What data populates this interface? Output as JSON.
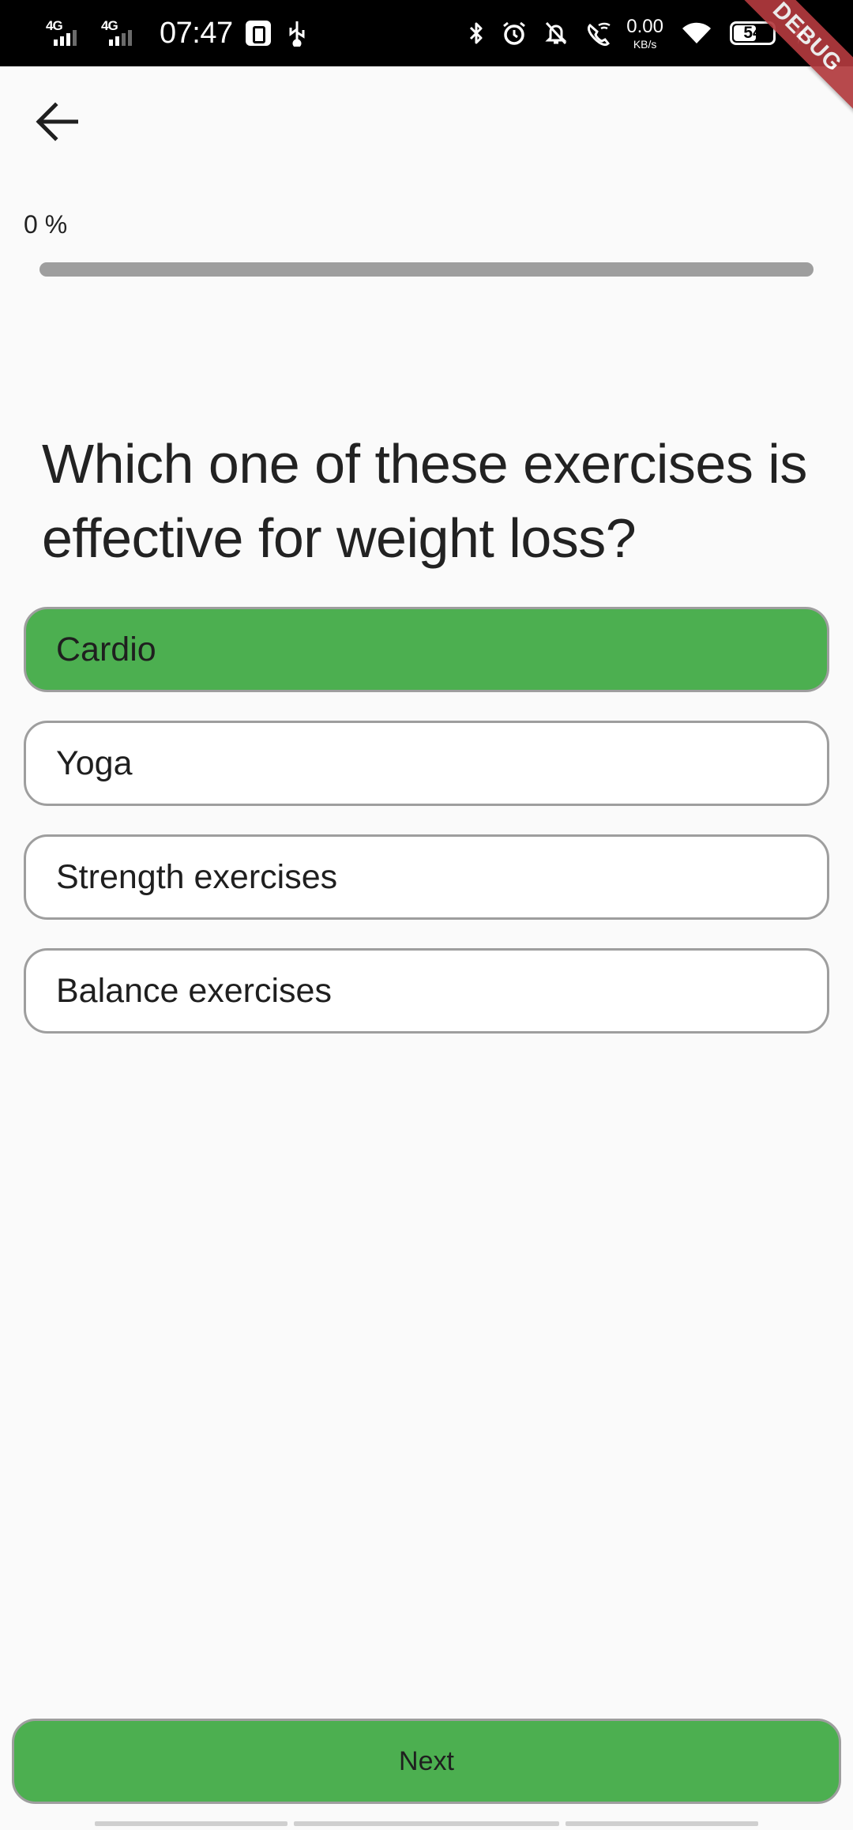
{
  "status_bar": {
    "sim1_tag": "4G",
    "sim2_tag": "4G",
    "time": "07:47",
    "net_speed_value": "0.00",
    "net_speed_unit": "KB/s",
    "battery_level": "54"
  },
  "debug_banner": "DEBUG",
  "progress": {
    "label": "0 %",
    "fraction": 0
  },
  "question": "Which one of these exercises is effective for weight loss?",
  "options": [
    {
      "label": "Cardio",
      "selected": true
    },
    {
      "label": "Yoga",
      "selected": false
    },
    {
      "label": "Strength exercises",
      "selected": false
    },
    {
      "label": "Balance exercises",
      "selected": false
    }
  ],
  "next_label": "Next",
  "colors": {
    "accent": "#4caf50",
    "track": "#9e9e9e",
    "background": "#fafafa"
  }
}
